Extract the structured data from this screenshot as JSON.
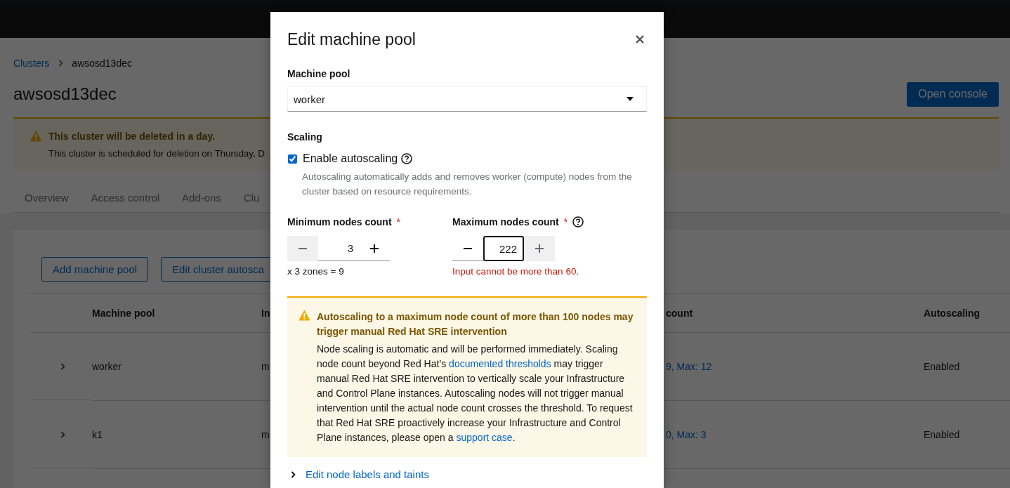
{
  "breadcrumb": [
    {
      "label": "Clusters",
      "kind": "link"
    },
    {
      "label": "awsosd13dec",
      "kind": "current"
    }
  ],
  "page_title": "awsosd13dec",
  "header_button": "Open console",
  "cluster_alert": {
    "title": "This cluster will be deleted in a day.",
    "body": "This cluster is scheduled for deletion on Thursday, D"
  },
  "tabs": [
    {
      "label": "Overview",
      "selected": false
    },
    {
      "label": "Access control",
      "selected": false
    },
    {
      "label": "Add-ons",
      "selected": false
    },
    {
      "label": "Clu",
      "selected": false
    }
  ],
  "toolbar_buttons": [
    "Add machine pool",
    "Edit cluster autosca"
  ],
  "table": {
    "columns": [
      {
        "label": "Machine pool",
        "kind": "text"
      },
      {
        "label": "In",
        "kind": "text"
      },
      {
        "label": "count",
        "kind": "link"
      },
      {
        "label": "Autoscaling",
        "kind": "text"
      }
    ],
    "rows": [
      {
        "expanded": false,
        "cells": [
          "worker",
          "m",
          "9, Max: 12",
          "Enabled"
        ]
      },
      {
        "expanded": false,
        "cells": [
          "k1",
          "m",
          "0, Max: 3",
          "Enabled"
        ]
      }
    ]
  },
  "modal": {
    "title": "Edit machine pool",
    "machine_pool": {
      "label": "Machine pool",
      "value": "worker"
    },
    "scaling": {
      "heading": "Scaling",
      "checkbox": {
        "label": "Enable autoscaling",
        "checked": true,
        "description": "Autoscaling automatically adds and removes worker (compute) nodes from the cluster based on resource requirements."
      }
    },
    "counts": [
      {
        "label": "Minimum nodes count",
        "required_mark": "*",
        "help": false,
        "value": "3",
        "minus_disabled": true,
        "plus_disabled": false,
        "focused": false,
        "helper": "x 3 zones = 9",
        "error": false
      },
      {
        "label": "Maximum nodes count",
        "required_mark": "*",
        "help": true,
        "value": "222",
        "minus_disabled": false,
        "plus_disabled": true,
        "focused": true,
        "helper": "Input cannot be more than 60.",
        "error": true
      }
    ],
    "warning": {
      "title": "Autoscaling to a maximum node count of more than 100 nodes may trigger manual Red Hat SRE intervention",
      "body": [
        {
          "kind": "text",
          "text": "Node scaling is automatic and will be performed immediately. Scaling node count beyond Red Hat’s "
        },
        {
          "kind": "link",
          "text": "documented thresholds"
        },
        {
          "kind": "text",
          "text": " may trigger manual Red Hat SRE intervention to vertically scale your Infrastructure and Control Plane instances. Autoscaling nodes will not trigger manual intervention until the actual node count crosses the threshold. To request that Red Hat SRE proactively increase your Infrastructure and Control Plane instances, please open a "
        },
        {
          "kind": "link",
          "text": "support case"
        },
        {
          "kind": "text",
          "text": "."
        }
      ]
    },
    "expandable": {
      "label": "Edit node labels and taints",
      "expanded": false
    }
  }
}
